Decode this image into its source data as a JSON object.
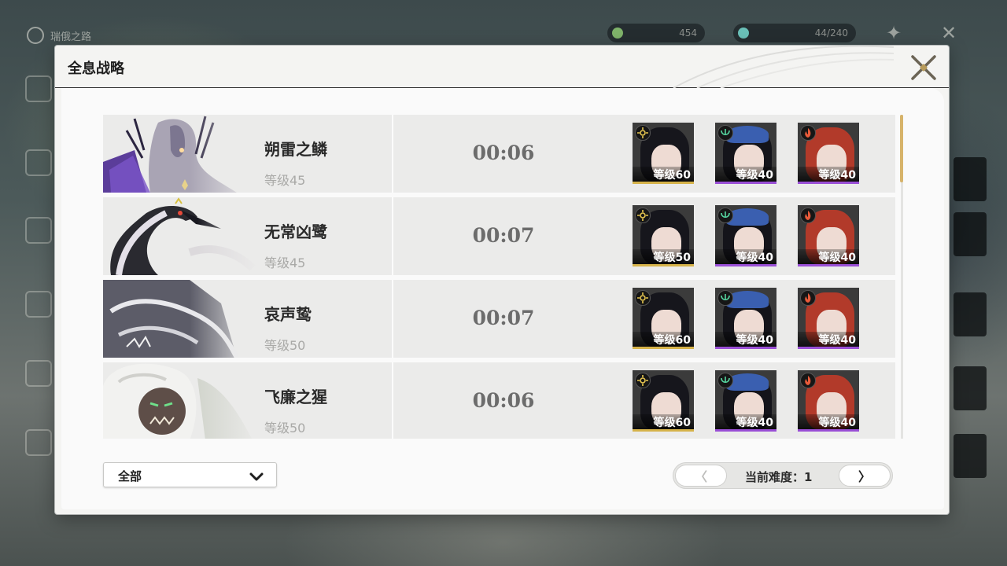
{
  "background": {
    "hud_title": "瑞俄之路",
    "resource_1": "454",
    "resource_2": "44/240"
  },
  "modal": {
    "title": "全息战略"
  },
  "bosses": [
    {
      "name": "朔雷之鳞",
      "level": "等级45",
      "time": "00:06",
      "team": [
        {
          "level": "等级60",
          "element": "spectro",
          "rarity_color": "#d6b34a"
        },
        {
          "level": "等级40",
          "element": "aero",
          "rarity_color": "#9a4fd6"
        },
        {
          "level": "等级40",
          "element": "fusion",
          "rarity_color": "#9a4fd6"
        }
      ]
    },
    {
      "name": "无常凶鹭",
      "level": "等级45",
      "time": "00:07",
      "team": [
        {
          "level": "等级50",
          "element": "spectro",
          "rarity_color": "#d6b34a"
        },
        {
          "level": "等级40",
          "element": "aero",
          "rarity_color": "#9a4fd6"
        },
        {
          "level": "等级40",
          "element": "fusion",
          "rarity_color": "#9a4fd6"
        }
      ]
    },
    {
      "name": "哀声鸷",
      "level": "等级50",
      "time": "00:07",
      "team": [
        {
          "level": "等级60",
          "element": "spectro",
          "rarity_color": "#d6b34a"
        },
        {
          "level": "等级40",
          "element": "aero",
          "rarity_color": "#9a4fd6"
        },
        {
          "level": "等级40",
          "element": "fusion",
          "rarity_color": "#9a4fd6"
        }
      ]
    },
    {
      "name": "飞廉之猩",
      "level": "等级50",
      "time": "00:06",
      "team": [
        {
          "level": "等级60",
          "element": "spectro",
          "rarity_color": "#d6b34a"
        },
        {
          "level": "等级40",
          "element": "aero",
          "rarity_color": "#9a4fd6"
        },
        {
          "level": "等级40",
          "element": "fusion",
          "rarity_color": "#9a4fd6"
        }
      ]
    }
  ],
  "filter": {
    "selected": "全部"
  },
  "pager": {
    "prev_icon": "〈",
    "next_icon": "〉",
    "label": "当前难度：1"
  }
}
